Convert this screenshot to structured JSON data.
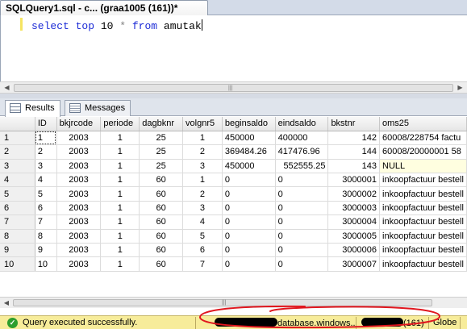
{
  "document_tab": {
    "title": "SQLQuery1.sql - c... (graa1005 (161))*"
  },
  "editor": {
    "tokens": [
      {
        "text": "select",
        "kind": "kw"
      },
      {
        "text": " ",
        "kind": "plain"
      },
      {
        "text": "top",
        "kind": "kw"
      },
      {
        "text": " 10 ",
        "kind": "plain"
      },
      {
        "text": "*",
        "kind": "op"
      },
      {
        "text": " ",
        "kind": "plain"
      },
      {
        "text": "from",
        "kind": "kw"
      },
      {
        "text": " amutak",
        "kind": "plain"
      }
    ],
    "keyword_color": "#1c2bd6"
  },
  "results_tabs": [
    {
      "label": "Results",
      "icon": "results-grid-icon",
      "active": true
    },
    {
      "label": "Messages",
      "icon": "messages-icon",
      "active": false
    }
  ],
  "results": {
    "columns": [
      "",
      "ID",
      "bkjrcode",
      "periode",
      "dagbknr",
      "volgnr5",
      "beginsaldo",
      "eindsaldo",
      "bkstnr",
      "oms25"
    ],
    "rows": [
      [
        "1",
        "1",
        "2003",
        "1",
        "25",
        "1",
        "450000",
        "400000",
        "142",
        "60008/228754 factu"
      ],
      [
        "2",
        "2",
        "2003",
        "1",
        "25",
        "2",
        "369484.26",
        "417476.96",
        "144",
        "60008/20000001 58"
      ],
      [
        "3",
        "3",
        "2003",
        "1",
        "25",
        "3",
        "450000",
        "552555.25",
        "143",
        "NULL"
      ],
      [
        "4",
        "4",
        "2003",
        "1",
        "60",
        "1",
        "0",
        "0",
        "3000001",
        "inkoopfactuur bestell"
      ],
      [
        "5",
        "5",
        "2003",
        "1",
        "60",
        "2",
        "0",
        "0",
        "3000002",
        "inkoopfactuur bestell"
      ],
      [
        "6",
        "6",
        "2003",
        "1",
        "60",
        "3",
        "0",
        "0",
        "3000003",
        "inkoopfactuur bestell"
      ],
      [
        "7",
        "7",
        "2003",
        "1",
        "60",
        "4",
        "0",
        "0",
        "3000004",
        "inkoopfactuur bestell"
      ],
      [
        "8",
        "8",
        "2003",
        "1",
        "60",
        "5",
        "0",
        "0",
        "3000005",
        "inkoopfactuur bestell"
      ],
      [
        "9",
        "9",
        "2003",
        "1",
        "60",
        "6",
        "0",
        "0",
        "3000006",
        "inkoopfactuur bestell"
      ],
      [
        "10",
        "10",
        "2003",
        "1",
        "60",
        "7",
        "0",
        "0",
        "3000007",
        "inkoopfactuur bestell"
      ]
    ]
  },
  "status_bar": {
    "message": "Query executed successfully.",
    "server_suffix": "database.windows....",
    "session": "(161)",
    "database": "Globe",
    "background": "#f7ec9a"
  },
  "annotation": {
    "color": "#e0161e"
  }
}
